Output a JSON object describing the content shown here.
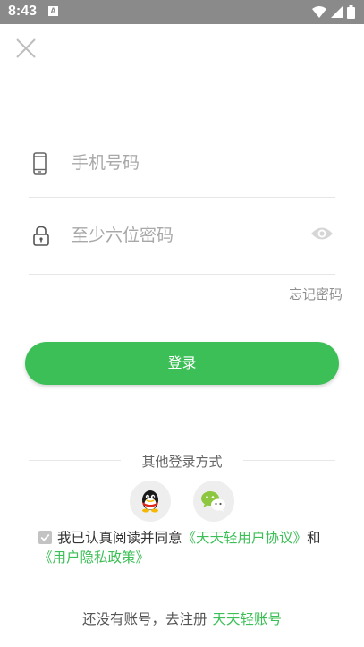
{
  "status_bar": {
    "time": "8:43",
    "badge": "A"
  },
  "icons": {
    "close": "close-icon",
    "phone": "phone-icon",
    "lock": "lock-icon",
    "eye": "eye-icon",
    "qq": "qq-icon",
    "wechat": "wechat-icon"
  },
  "form": {
    "phone_placeholder": "手机号码",
    "password_placeholder": "至少六位密码",
    "forgot_label": "忘记密码",
    "login_label": "登录"
  },
  "other_login": {
    "label": "其他登录方式"
  },
  "agreement": {
    "prefix": "我已认真阅读并同意",
    "user_agreement": "《天天轻用户协议》",
    "and": "和",
    "privacy_policy": "《用户隐私政策》"
  },
  "register": {
    "prompt": "还没有账号，去注册",
    "link": "天天轻账号"
  },
  "colors": {
    "accent": "#3dbf57",
    "status_bar": "#8a8a8a"
  }
}
